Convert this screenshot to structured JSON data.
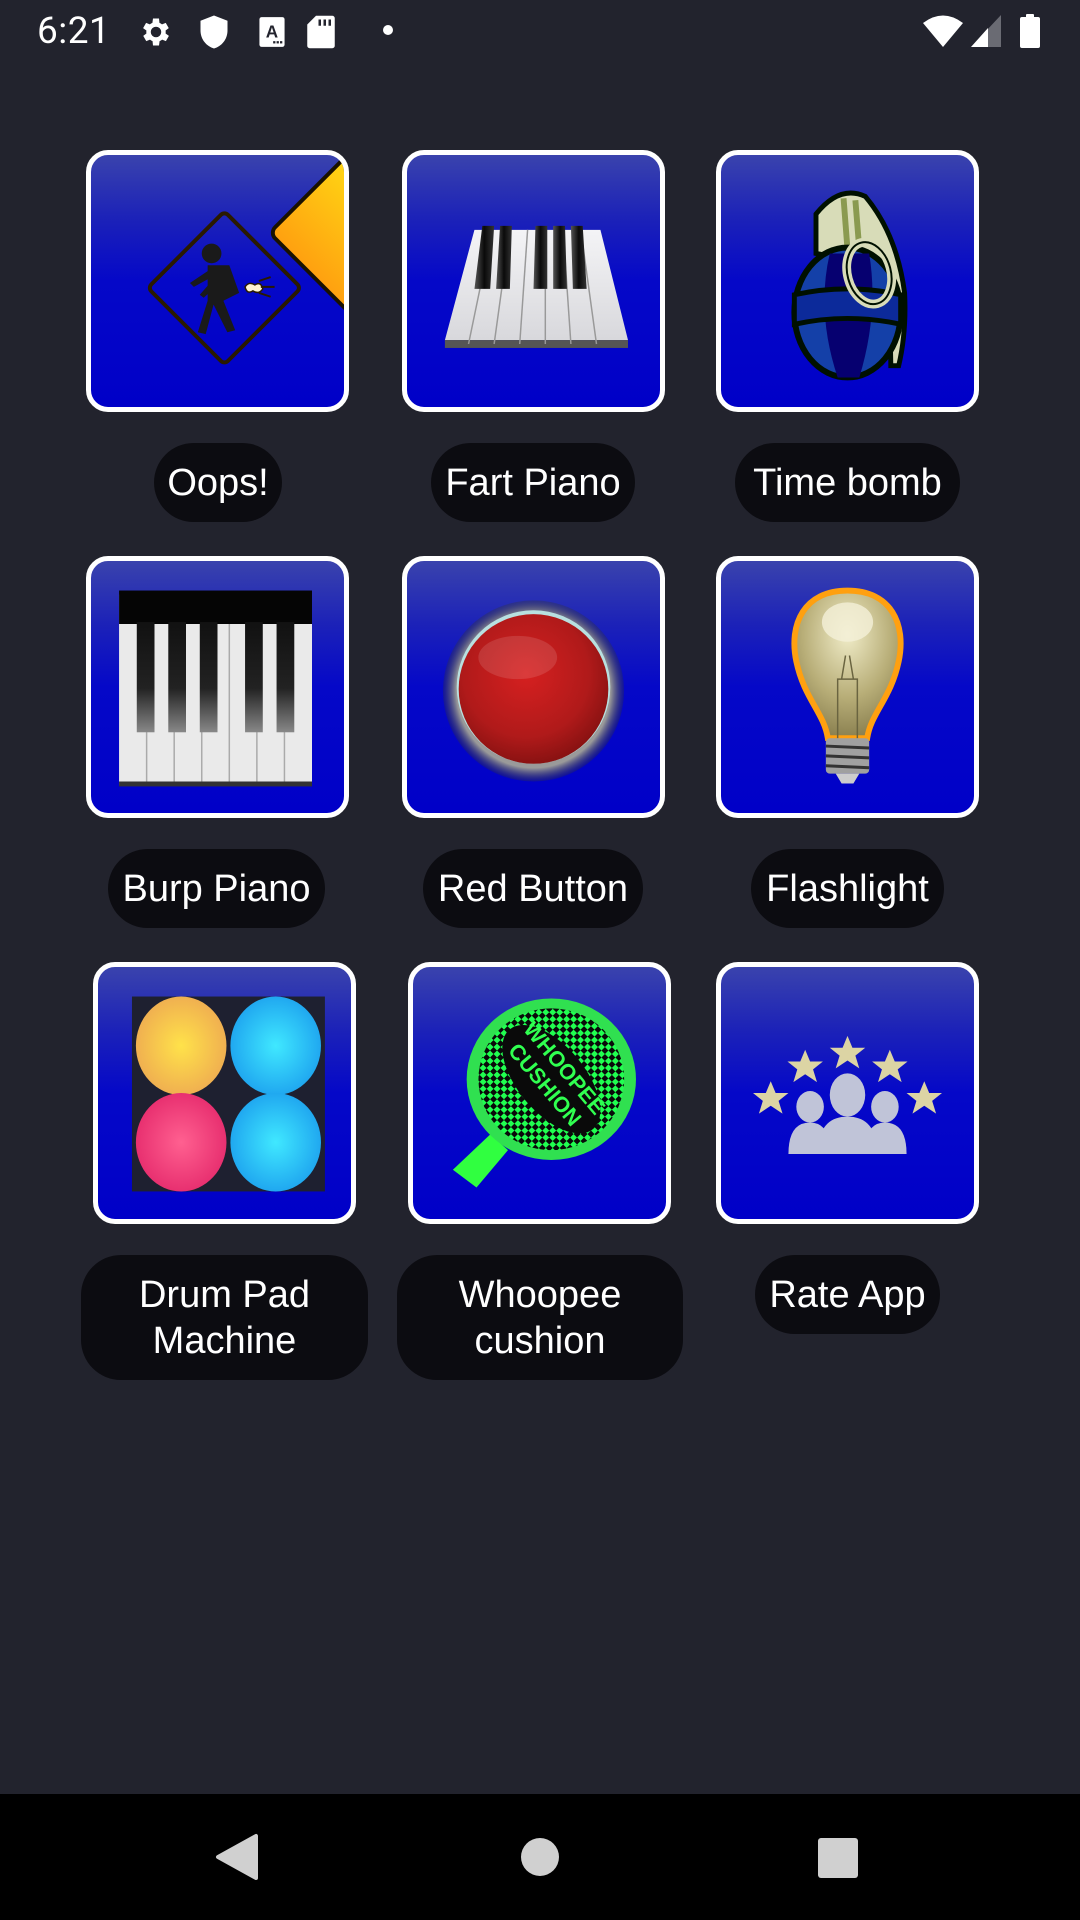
{
  "status_bar": {
    "time": "6:21",
    "left_icons": [
      "gear-icon",
      "shield-icon",
      "keyboard-a-icon",
      "sd-card-icon",
      "notification-dot-icon"
    ],
    "right_icons": [
      "wifi-icon",
      "cell-signal-icon",
      "battery-icon"
    ]
  },
  "grid": {
    "items": [
      {
        "label": "Oops!",
        "icon": "fart-warning-sign-icon"
      },
      {
        "label": "Fart Piano",
        "icon": "piano-keys-icon"
      },
      {
        "label": "Time bomb",
        "icon": "grenade-icon"
      },
      {
        "label": "Burp Piano",
        "icon": "piano-vertical-icon"
      },
      {
        "label": "Red Button",
        "icon": "red-button-icon"
      },
      {
        "label": "Flashlight",
        "icon": "light-bulb-icon"
      },
      {
        "label": "Drum Pad\nMachine",
        "icon": "drum-pads-icon"
      },
      {
        "label": "Whoopee\ncushion",
        "icon": "whoopee-cushion-icon"
      },
      {
        "label": "Rate App",
        "icon": "rating-stars-icon"
      }
    ],
    "whoopee_text": [
      "WHOOPEE",
      "CUSHION"
    ]
  },
  "nav_bar": {
    "back": "back-icon",
    "home": "home-icon",
    "recents": "recents-icon"
  },
  "colors": {
    "background": "#22232d",
    "tile_blue": "#0000c8",
    "tile_border": "#ffffff",
    "pill": "#0c0c11"
  }
}
